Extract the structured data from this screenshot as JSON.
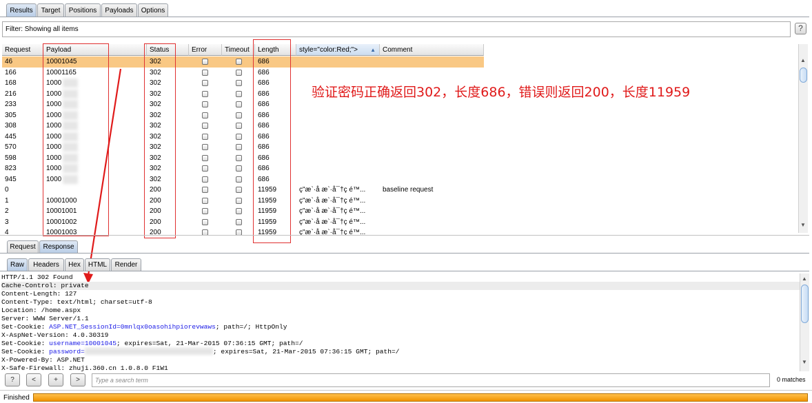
{
  "tabs": [
    "Results",
    "Target",
    "Positions",
    "Payloads",
    "Options"
  ],
  "filter": {
    "text": "Filter: Showing all items",
    "help": "?"
  },
  "table": {
    "columns": [
      "Request",
      "Payload",
      "Status",
      "Error",
      "Timeout",
      "Length",
      "style=\"color:Red;\">",
      "Comment"
    ],
    "rows": [
      {
        "request": "46",
        "payload": "10001045",
        "status": "302",
        "length": "686",
        "col7": "",
        "comment": "",
        "selected": true
      },
      {
        "request": "166",
        "payload": "10001165",
        "status": "302",
        "length": "686",
        "col7": "",
        "comment": ""
      },
      {
        "request": "168",
        "payload": "1000",
        "status": "302",
        "length": "686",
        "col7": "",
        "comment": ""
      },
      {
        "request": "216",
        "payload": "1000",
        "status": "302",
        "length": "686",
        "col7": "",
        "comment": ""
      },
      {
        "request": "233",
        "payload": "1000",
        "status": "302",
        "length": "686",
        "col7": "",
        "comment": ""
      },
      {
        "request": "305",
        "payload": "1000",
        "status": "302",
        "length": "686",
        "col7": "",
        "comment": ""
      },
      {
        "request": "308",
        "payload": "1000",
        "status": "302",
        "length": "686",
        "col7": "",
        "comment": ""
      },
      {
        "request": "445",
        "payload": "1000",
        "status": "302",
        "length": "686",
        "col7": "",
        "comment": ""
      },
      {
        "request": "570",
        "payload": "1000",
        "status": "302",
        "length": "686",
        "col7": "",
        "comment": ""
      },
      {
        "request": "598",
        "payload": "1000",
        "status": "302",
        "length": "686",
        "col7": "",
        "comment": ""
      },
      {
        "request": "823",
        "payload": "1000",
        "status": "302",
        "length": "686",
        "col7": "",
        "comment": ""
      },
      {
        "request": "945",
        "payload": "1000",
        "status": "302",
        "length": "686",
        "col7": "",
        "comment": ""
      },
      {
        "request": "0",
        "payload": "",
        "status": "200",
        "length": "11959",
        "col7": "ç\"æ`·å æ`·å¯†ç é™...",
        "comment": "baseline request"
      },
      {
        "request": "1",
        "payload": "10001000",
        "status": "200",
        "length": "11959",
        "col7": "ç\"æ`·å æ`·å¯†ç é™...",
        "comment": ""
      },
      {
        "request": "2",
        "payload": "10001001",
        "status": "200",
        "length": "11959",
        "col7": "ç\"æ`·å æ`·å¯†ç é™...",
        "comment": ""
      },
      {
        "request": "3",
        "payload": "10001002",
        "status": "200",
        "length": "11959",
        "col7": "ç\"æ`·å æ`·å¯†ç é™...",
        "comment": ""
      },
      {
        "request": "4",
        "payload": "10001003",
        "status": "200",
        "length": "11959",
        "col7": "ç\"æ`·å æ`·å¯†ç é™...",
        "comment": ""
      }
    ]
  },
  "annotation": "验证密码正确返回302，长度686，错误则返回200，长度11959",
  "reqresp_tabs": [
    "Request",
    "Response"
  ],
  "view_tabs": [
    "Raw",
    "Headers",
    "Hex",
    "HTML",
    "Render"
  ],
  "raw": {
    "l1": "HTTP/1.1 302 Found",
    "l2": "Cache-Control: private",
    "l3": "Content-Length: 127",
    "l4": "Content-Type: text/html; charset=utf-8",
    "l5": "Location: /home.aspx",
    "l6": "Server: WWW Server/1.1",
    "l7a": "Set-Cookie: ",
    "l7b": "ASP.NET_SessionId=0mnlqx0oasohihpiorevwaws",
    "l7c": "; path=/; HttpOnly",
    "l8": "X-AspNet-Version: 4.0.30319",
    "l9a": "Set-Cookie: ",
    "l9b": "username=10001045",
    "l9c": "; expires=Sat, 21-Mar-2015 07:36:15 GMT; path=/",
    "l10a": "Set-Cookie: ",
    "l10b": "password=",
    "l10c": "; expires=Sat, 21-Mar-2015 07:36:15 GMT; path=/",
    "l11": "X-Powered-By: ASP.NET",
    "l12": "X-Safe-Firewall: zhuji.360.cn 1.0.8.0 F1W1"
  },
  "bottom": {
    "buttons": [
      "?",
      "<",
      "+",
      ">"
    ],
    "search_placeholder": "Type a search term",
    "matches": "0 matches"
  },
  "status": {
    "text": "Finished",
    "progress": 1.0
  },
  "colors": {
    "selected_row": "#f9c884",
    "annotation": "#e01a1a",
    "progress": "#f29400"
  }
}
